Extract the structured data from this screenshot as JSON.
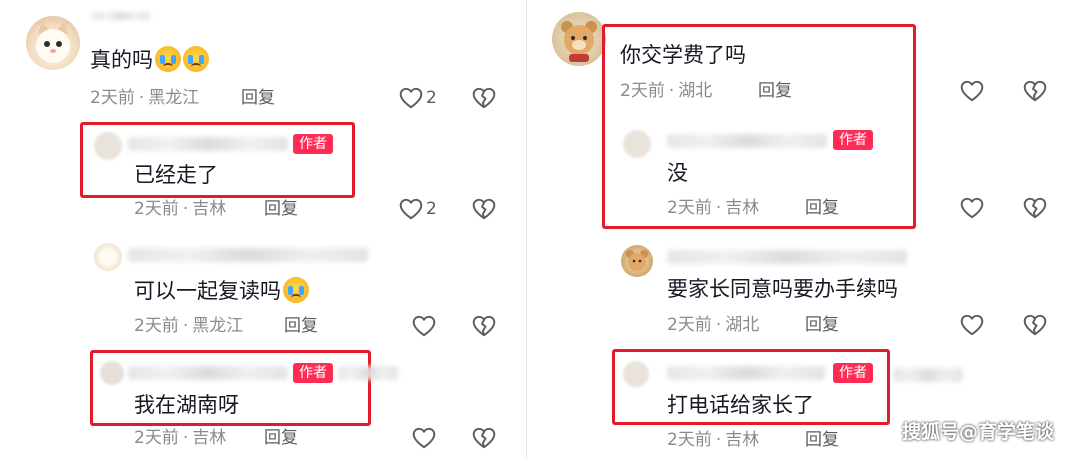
{
  "left": {
    "comment1": {
      "text": "真的吗",
      "location": "黑龙江",
      "time": "2天前",
      "reply": "回复",
      "likes": "2"
    },
    "reply1": {
      "badge": "作者",
      "text": "已经走了",
      "time": "2天前",
      "location": "吉林",
      "reply": "回复",
      "likes": "2"
    },
    "reply2": {
      "text": "可以一起复读吗",
      "time": "2天前",
      "location": "黑龙江",
      "reply": "回复"
    },
    "reply3": {
      "badge": "作者",
      "text": "我在湖南呀",
      "time": "2天前",
      "location": "吉林",
      "reply": "回复"
    }
  },
  "right": {
    "comment1": {
      "text": "你交学费了吗",
      "time": "2天前",
      "location": "湖北",
      "reply": "回复"
    },
    "reply1": {
      "badge": "作者",
      "text": "没",
      "time": "2天前",
      "location": "吉林",
      "reply": "回复"
    },
    "reply2": {
      "text": "要家长同意吗要办手续吗",
      "time": "2天前",
      "location": "湖北",
      "reply": "回复"
    },
    "reply3": {
      "badge": "作者",
      "text": "打电话给家长了",
      "time": "2天前",
      "location": "吉林",
      "reply": "回复"
    }
  },
  "separator": "·",
  "watermark": "搜狐号@育学笔谈",
  "icons": {
    "like": "heart-outline-icon",
    "dislike": "broken-heart-icon"
  },
  "colors": {
    "author_badge": "#fe2c55",
    "highlight_box": "#e11b28",
    "meta_text": "#8a8b91"
  }
}
